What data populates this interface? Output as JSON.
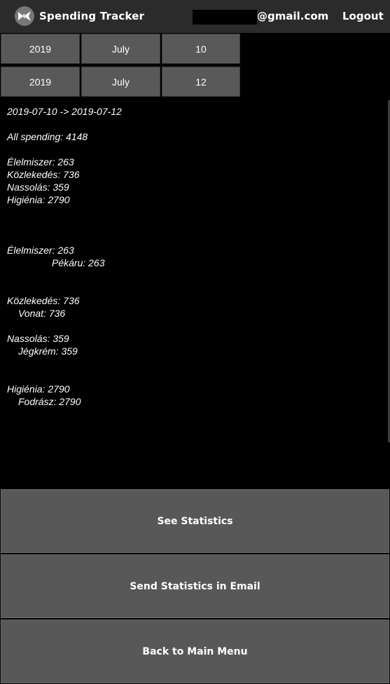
{
  "header": {
    "title": "Spending Tracker",
    "email_suffix": "@gmail.com",
    "logout_label": "Logout",
    "logo_icon": "kivy-logo-icon"
  },
  "date_from": {
    "year": "2019",
    "month": "July",
    "day": "10"
  },
  "date_to": {
    "year": "2019",
    "month": "July",
    "day": "12"
  },
  "results": {
    "range": "2019-07-10 -> 2019-07-12",
    "all_spending": "All spending: 4148",
    "summary": [
      "Élelmiszer: 263",
      "Közlekedés: 736",
      "Nassolás: 359",
      "Higiénia: 2790"
    ],
    "details": [
      {
        "category": "Élelmiszer: 263",
        "sub": "Pékáru: 263"
      },
      {
        "category": "Közlekedés: 736",
        "sub": "Vonat: 736"
      },
      {
        "category": "Nassolás: 359",
        "sub": "Jégkrém: 359"
      },
      {
        "category": "Higiénia: 2790",
        "sub": "Fodrász: 2790"
      }
    ]
  },
  "buttons": {
    "see_statistics": "See Statistics",
    "send_email": "Send Statistics in Email",
    "back": "Back to Main Menu"
  }
}
